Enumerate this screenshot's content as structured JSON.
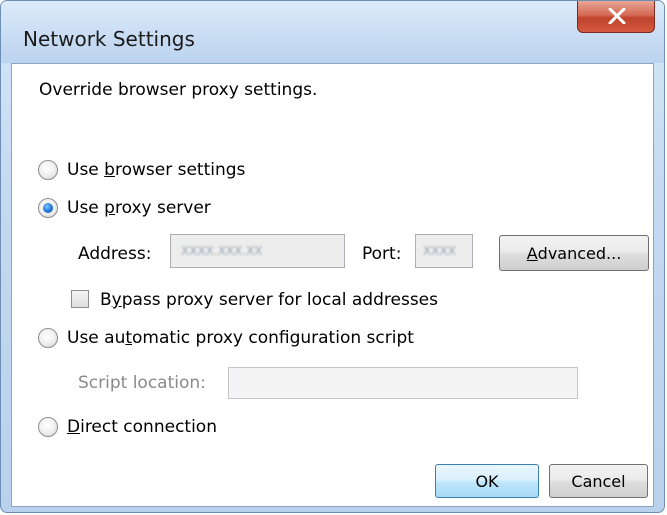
{
  "window": {
    "title": "Network Settings",
    "close_glyph": "X"
  },
  "intro": "Override browser proxy settings.",
  "options": {
    "browser": {
      "pre": "Use ",
      "accel": "b",
      "post": "rowser settings",
      "selected": false
    },
    "proxy": {
      "pre": "Use ",
      "accel": "p",
      "post": "roxy server",
      "selected": true
    },
    "auto": {
      "pre": "Use au",
      "accel": "t",
      "post": "omatic proxy configuration script",
      "selected": false
    },
    "direct": {
      "pre": "",
      "accel": "D",
      "post": "irect connection",
      "selected": false
    }
  },
  "proxy": {
    "address_label": "Address:",
    "address_value": "XXXX.XXX.XX",
    "port_label": "Port:",
    "port_value": "XXXX",
    "advanced_pre": "",
    "advanced_accel": "A",
    "advanced_post": "dvanced...",
    "bypass_pre": "B",
    "bypass_accel": "y",
    "bypass_post": "pass proxy server for local addresses",
    "bypass_checked": false
  },
  "script": {
    "location_label": "Script location:",
    "location_value": ""
  },
  "buttons": {
    "ok": "OK",
    "cancel": "Cancel"
  }
}
